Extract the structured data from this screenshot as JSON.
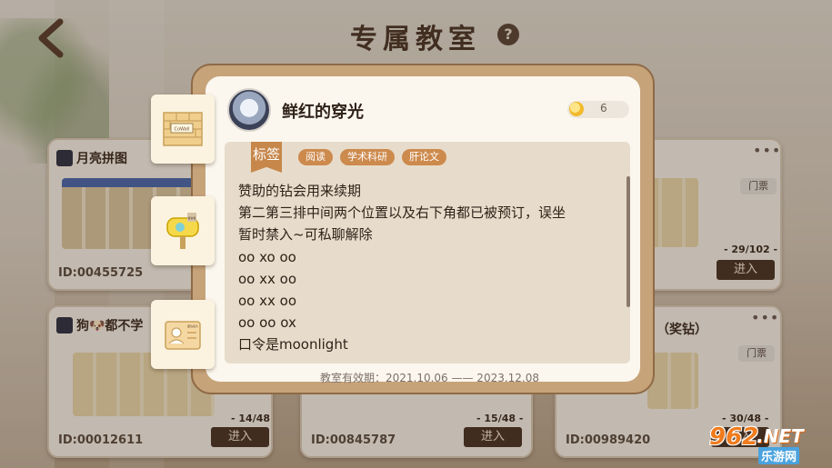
{
  "header": {
    "title": "专属教室",
    "help": "?"
  },
  "cards": [
    {
      "title": "月亮拼图",
      "id": "ID:00455725",
      "count": "",
      "enter": ""
    },
    {
      "title": "",
      "id": "",
      "count": "- 29/102 -",
      "enter": "进入",
      "ticket": "门票"
    },
    {
      "title": "狗🐶都不学",
      "id": "ID:00012611",
      "count": "- 14/48 -",
      "enter": "进入"
    },
    {
      "title": "",
      "id": "ID:00845787",
      "count": "- 15/48 -",
      "enter": "进入"
    },
    {
      "title": "（奖钻）",
      "id": "ID:00989420",
      "count": "- 30/48 -",
      "enter": "进入",
      "ticket": "门票"
    }
  ],
  "more": "•••",
  "modal": {
    "user_name": "鲜红的穿光",
    "coins": "6",
    "tag_label": "标签",
    "tags": [
      "阅读",
      "学术科研",
      "肝论文"
    ],
    "description": [
      "赞助的钻会用来续期",
      "第二第三排中间两个位置以及右下角都已被预订，误坐",
      "暂时禁入~可私聊解除",
      "oo xo oo",
      "oo xx oo",
      "oo xx oo",
      "oo oo ox",
      "口令是moonlight"
    ],
    "validity": "教室有效期：2021.10.06 —— 2023.12.08"
  },
  "side_tabs": [
    "CoWall",
    "留言板",
    "座位名片"
  ],
  "watermark": {
    "num": "962",
    "net": ".NET",
    "sub": "乐游网"
  }
}
